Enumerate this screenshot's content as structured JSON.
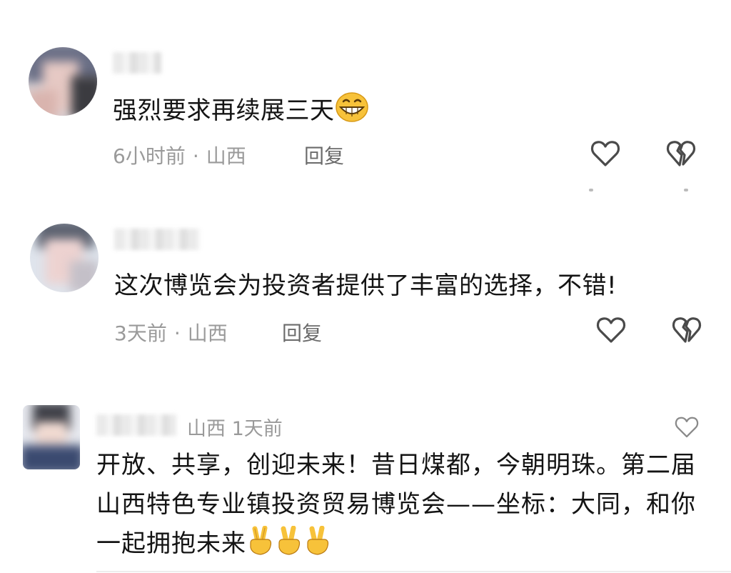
{
  "comments": [
    {
      "text": "强烈要求再续展三天",
      "emoji": "grinning-face",
      "time": "6小时前",
      "location": "山西",
      "reply_label": "回复"
    },
    {
      "text": "这次博览会为投资者提供了丰富的选择，不错!",
      "time": "3天前",
      "location": "山西",
      "reply_label": "回复"
    },
    {
      "location": "山西",
      "time": "1天前",
      "text": "开放、共享，创迎未来！昔日煤都，今朝明珠。第二届山西特色专业镇投资贸易博览会——坐标：大同，和你一起拥抱未来",
      "emoji": "victory-hand",
      "emoji_count": 3
    }
  ],
  "separator": "·",
  "colors": {
    "text": "#141414",
    "meta": "#9a9a9a",
    "reply": "#6b6b6b",
    "icon": "#4a4a4a",
    "emoji": "#f7c23a"
  },
  "icons": {
    "like": "heart-outline-icon",
    "dislike": "broken-heart-icon"
  }
}
